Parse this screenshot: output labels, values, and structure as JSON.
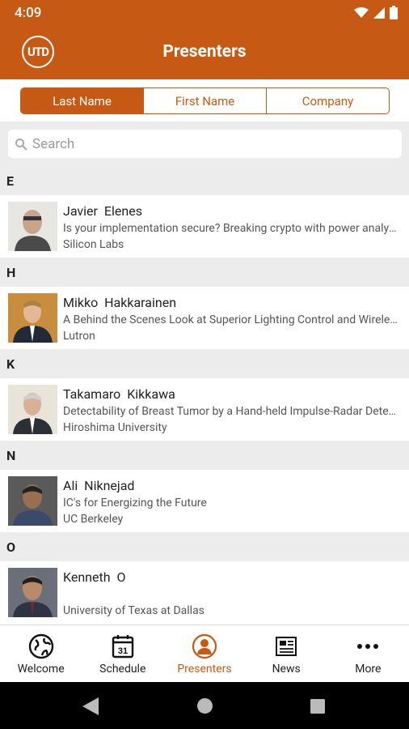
{
  "status_bar": {
    "time": "4:09"
  },
  "app_bar": {
    "logo_text": "UTD",
    "title": "Presenters"
  },
  "segments": [
    {
      "label": "Last Name",
      "selected": true
    },
    {
      "label": "First Name",
      "selected": false
    },
    {
      "label": "Company",
      "selected": false
    }
  ],
  "search": {
    "placeholder": "Search"
  },
  "sections": [
    {
      "letter": "E",
      "presenters": [
        {
          "first": "Javier",
          "last": "Elenes",
          "talk": "Is your implementation secure? Breaking crypto with power analysis attacks",
          "org": "Silicon Labs"
        }
      ]
    },
    {
      "letter": "H",
      "presenters": [
        {
          "first": "Mikko",
          "last": "Hakkarainen",
          "talk": "A Behind the Scenes Look at Superior Lighting Control and Wireless Design",
          "org": "Lutron"
        }
      ]
    },
    {
      "letter": "K",
      "presenters": [
        {
          "first": "Takamaro",
          "last": "Kikkawa",
          "talk": "Detectability of Breast Tumor by a Hand-held Impulse-Radar Detector",
          "org": "Hiroshima University"
        }
      ]
    },
    {
      "letter": "N",
      "presenters": [
        {
          "first": "Ali",
          "last": "Niknejad",
          "talk": "IC's for Energizing the Future",
          "org": "UC Berkeley"
        }
      ]
    },
    {
      "letter": "O",
      "presenters": [
        {
          "first": "Kenneth",
          "last": "O",
          "talk": "",
          "org": "University of Texas at Dallas"
        }
      ]
    }
  ],
  "bottom_tabs": [
    {
      "label": "Welcome",
      "icon": "globe-icon",
      "active": false
    },
    {
      "label": "Schedule",
      "icon": "calendar-icon",
      "calendar_day": "31",
      "active": false
    },
    {
      "label": "Presenters",
      "icon": "person-icon",
      "active": true
    },
    {
      "label": "News",
      "icon": "newspaper-icon",
      "active": false
    },
    {
      "label": "More",
      "icon": "more-dots-icon",
      "active": false
    }
  ],
  "colors": {
    "accent": "#c65a14",
    "section_bg": "#ececec",
    "nav_bg": "#000000"
  }
}
